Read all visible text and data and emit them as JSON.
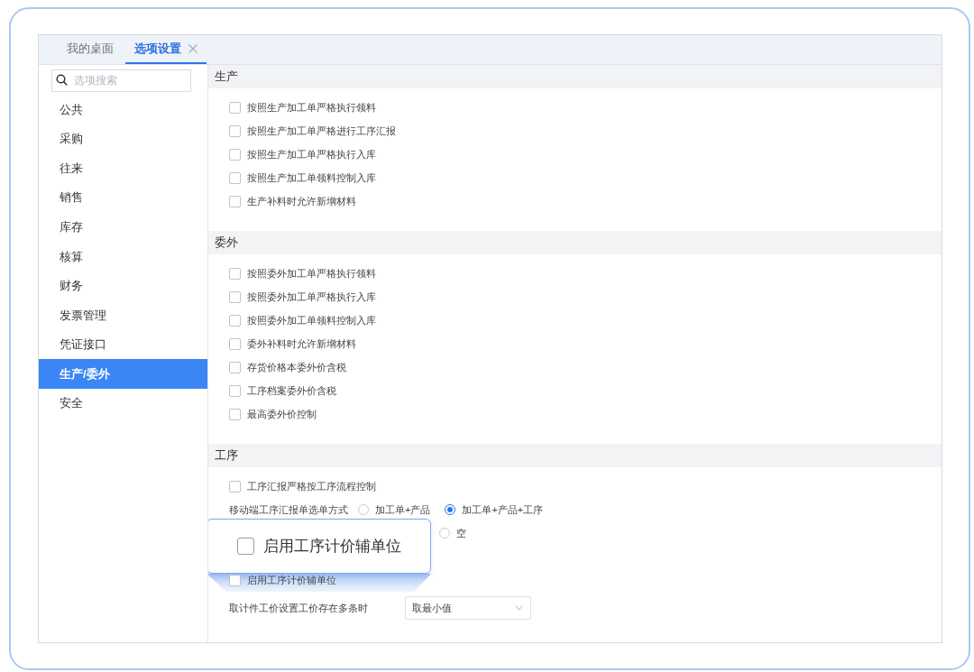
{
  "tabs": [
    {
      "label": "我的桌面",
      "selected": false,
      "closable": false
    },
    {
      "label": "选项设置",
      "selected": true,
      "closable": true
    }
  ],
  "sidebar": {
    "search": {
      "placeholder": "选项搜索"
    },
    "items": [
      {
        "label": "公共",
        "selected": false
      },
      {
        "label": "采购",
        "selected": false
      },
      {
        "label": "往来",
        "selected": false
      },
      {
        "label": "销售",
        "selected": false
      },
      {
        "label": "库存",
        "selected": false
      },
      {
        "label": "核算",
        "selected": false
      },
      {
        "label": "财务",
        "selected": false
      },
      {
        "label": "发票管理",
        "selected": false
      },
      {
        "label": "凭证接口",
        "selected": false
      },
      {
        "label": "生产/委外",
        "selected": true
      },
      {
        "label": "安全",
        "selected": false
      }
    ]
  },
  "sections": [
    {
      "title": "生产",
      "options": [
        {
          "kind": "checkbox",
          "label": "按照生产加工单严格执行领料",
          "checked": false
        },
        {
          "kind": "checkbox",
          "label": "按照生产加工单严格进行工序汇报",
          "checked": false
        },
        {
          "kind": "checkbox",
          "label": "按照生产加工单严格执行入库",
          "checked": false
        },
        {
          "kind": "checkbox",
          "label": "按照生产加工单领料控制入库",
          "checked": false
        },
        {
          "kind": "checkbox",
          "label": "生产补料时允许新增材料",
          "checked": false
        }
      ]
    },
    {
      "title": "委外",
      "options": [
        {
          "kind": "checkbox",
          "label": "按照委外加工单严格执行领料",
          "checked": false
        },
        {
          "kind": "checkbox",
          "label": "按照委外加工单严格执行入库",
          "checked": false
        },
        {
          "kind": "checkbox",
          "label": "按照委外加工单领料控制入库",
          "checked": false
        },
        {
          "kind": "checkbox",
          "label": "委外补料时允许新增材料",
          "checked": false
        },
        {
          "kind": "checkbox",
          "label": "存货价格本委外价含税",
          "checked": false
        },
        {
          "kind": "checkbox",
          "label": "工序档案委外价含税",
          "checked": false
        },
        {
          "kind": "checkbox",
          "label": "最高委外价控制",
          "checked": false
        }
      ]
    },
    {
      "title": "工序",
      "options": [
        {
          "kind": "checkbox",
          "label": "工序汇报严格按工序流程控制",
          "checked": false
        },
        {
          "kind": "radio_group",
          "label": "移动端工序汇报单选单方式",
          "choices": [
            {
              "label": "加工单+产品",
              "selected": false
            },
            {
              "label": "加工单+产品+工序",
              "selected": true
            }
          ]
        },
        {
          "kind": "radio_group",
          "choices": [
            {
              "label": "空",
              "selected": false
            }
          ]
        },
        {
          "kind": "callout",
          "label": "启用工序计价辅单位",
          "checked": false
        },
        {
          "kind": "checkbox",
          "label": "启用工序计价辅单位",
          "checked": false
        },
        {
          "kind": "select",
          "label": "取计件工价设置工价存在多条时",
          "value": "取最小值"
        }
      ]
    }
  ]
}
